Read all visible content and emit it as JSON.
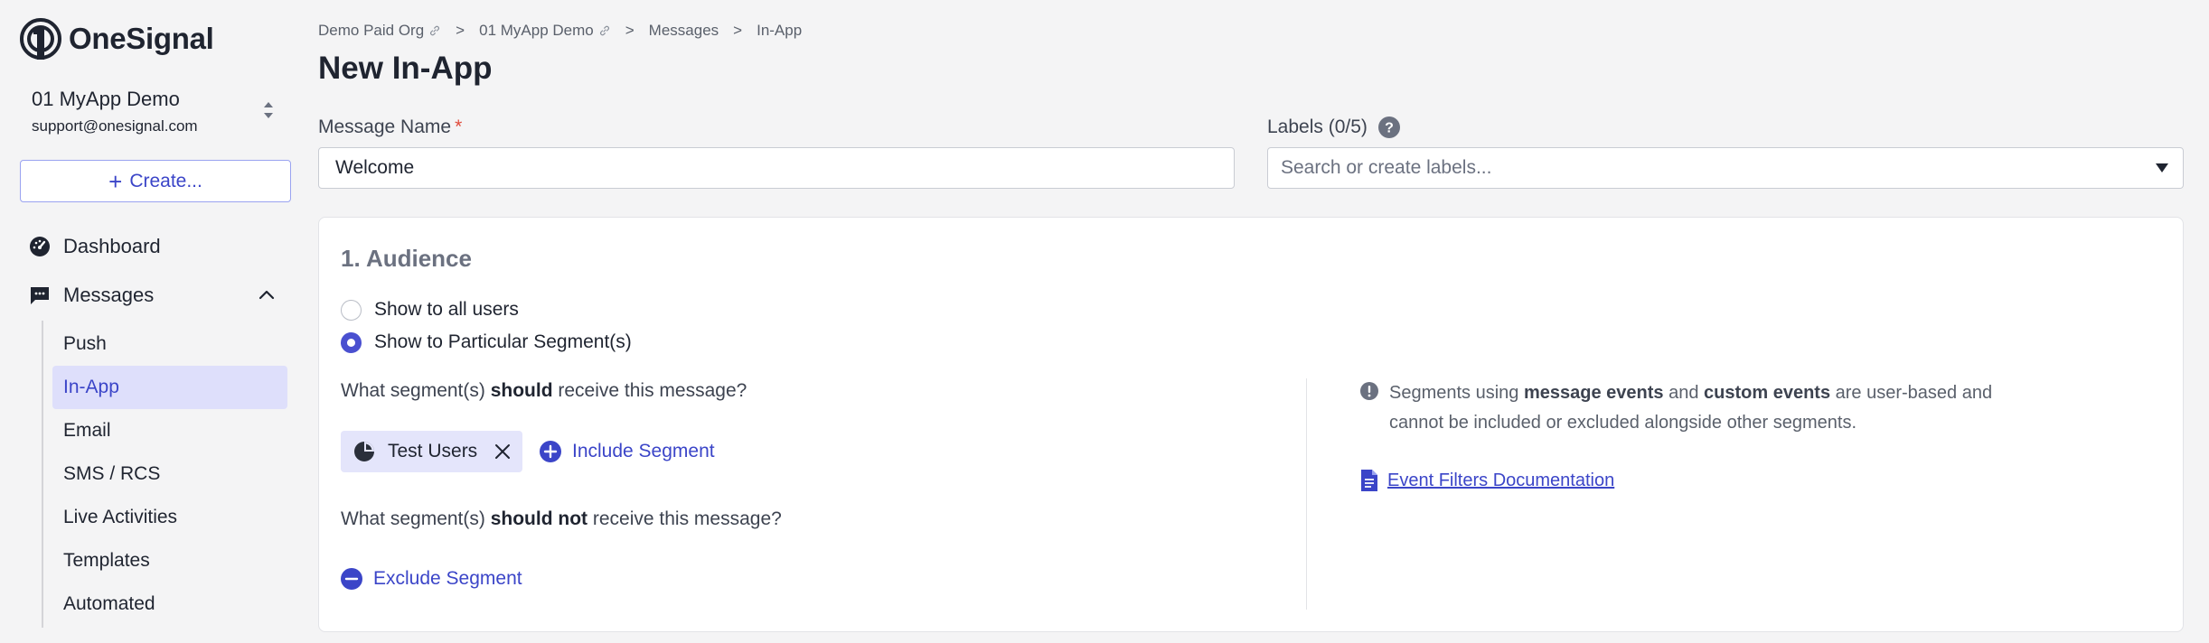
{
  "brand": {
    "name": "OneSignal",
    "accent": "#3b45c8",
    "logo_icon": "onesignal-logo-icon"
  },
  "app": {
    "name": "01 MyApp Demo",
    "email": "support@onesignal.com"
  },
  "sidebar": {
    "create_label": "Create...",
    "items": [
      {
        "label": "Dashboard",
        "icon": "dashboard-gauge-icon"
      },
      {
        "label": "Messages",
        "icon": "message-bubble-icon"
      }
    ],
    "sub_items": [
      {
        "label": "Push"
      },
      {
        "label": "In-App",
        "active": true
      },
      {
        "label": "Email"
      },
      {
        "label": "SMS / RCS"
      },
      {
        "label": "Live Activities"
      },
      {
        "label": "Templates"
      },
      {
        "label": "Automated"
      }
    ]
  },
  "breadcrumb": [
    "Demo Paid Org",
    "01 MyApp Demo",
    "Messages",
    "In-App"
  ],
  "page": {
    "title": "New In-App"
  },
  "form": {
    "message_name_label": "Message Name",
    "required_mark": "*",
    "message_name_value": "Welcome",
    "labels_label": "Labels (0/5)",
    "labels_placeholder": "Search or create labels..."
  },
  "audience": {
    "title": "1. Audience",
    "options": [
      {
        "label": "Show to all users",
        "checked": false
      },
      {
        "label": "Show to Particular Segment(s)",
        "checked": true
      }
    ],
    "include_q": {
      "pre": "What segment(s) ",
      "bold": "should",
      "post": " receive this message?"
    },
    "exclude_q": {
      "pre": "What segment(s) ",
      "bold": "should not",
      "post": " receive this message?"
    },
    "included_segment": "Test Users",
    "include_label": "Include Segment",
    "exclude_label": "Exclude Segment",
    "info": {
      "p1": "Segments using ",
      "b1": "message events",
      "p2": " and ",
      "b2": "custom events",
      "p3": " are user-based and cannot be included or excluded alongside other segments."
    },
    "doc_link": "Event Filters Documentation"
  }
}
